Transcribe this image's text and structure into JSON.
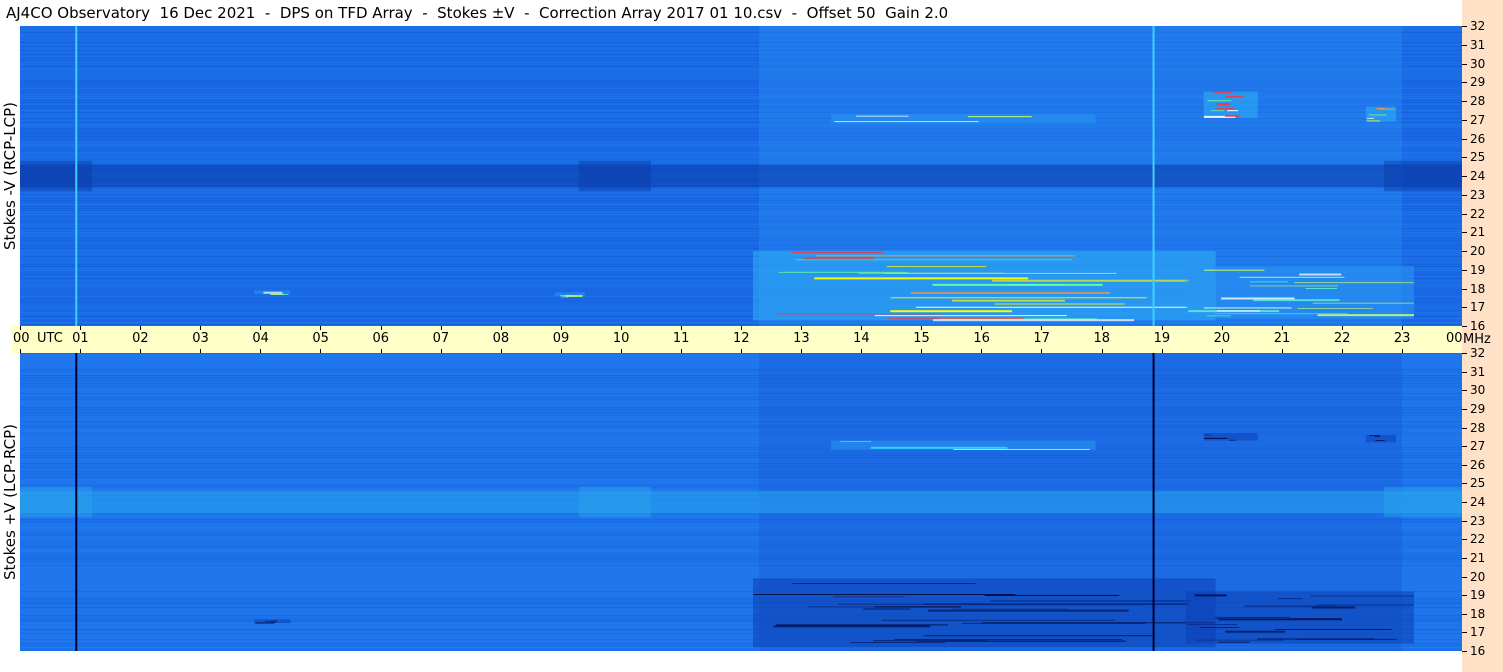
{
  "title": "AJ4CO Observatory  16 Dec 2021  -  DPS on TFD Array  -  Stokes ±V  -  Correction Array 2017 01 10.csv  -  Offset 50  Gain 2.0",
  "chart_data": {
    "type": "heatmap",
    "panels": [
      {
        "name": "top",
        "ylabel": "Stokes -V (RCP-LCP)",
        "baseline_color": "#1a6ae6",
        "marker_line_color": "#3fd0ff",
        "marker_lines_utc_hours": [
          0.92,
          18.85
        ],
        "dark_band_freq_mhz": [
          23.4,
          24.6
        ],
        "bursts": [
          {
            "start_utc": 12.2,
            "end_utc": 19.9,
            "freq_low": 16.3,
            "freq_high": 20.0,
            "intensity": "high"
          },
          {
            "start_utc": 19.4,
            "end_utc": 23.2,
            "freq_low": 16.4,
            "freq_high": 19.2,
            "intensity": "medium"
          },
          {
            "start_utc": 13.5,
            "end_utc": 17.9,
            "freq_low": 26.8,
            "freq_high": 27.3,
            "intensity": "medium"
          },
          {
            "start_utc": 19.7,
            "end_utc": 20.6,
            "freq_low": 27.1,
            "freq_high": 28.5,
            "intensity": "high"
          },
          {
            "start_utc": 22.4,
            "end_utc": 22.9,
            "freq_low": 26.9,
            "freq_high": 27.7,
            "intensity": "high"
          },
          {
            "start_utc": 3.9,
            "end_utc": 4.5,
            "freq_low": 17.7,
            "freq_high": 17.9,
            "intensity": "medium"
          },
          {
            "start_utc": 8.9,
            "end_utc": 9.4,
            "freq_low": 17.6,
            "freq_high": 17.8,
            "intensity": "medium"
          }
        ]
      },
      {
        "name": "bottom",
        "ylabel": "Stokes +V (LCP-RCP)",
        "baseline_color": "#1e74ea",
        "marker_line_color": "#000033",
        "marker_lines_utc_hours": [
          0.92,
          18.85
        ],
        "bright_band_freq_mhz": [
          23.4,
          24.6
        ],
        "bursts": [
          {
            "start_utc": 12.2,
            "end_utc": 19.9,
            "freq_low": 16.2,
            "freq_high": 19.9,
            "intensity": "low"
          },
          {
            "start_utc": 19.4,
            "end_utc": 23.2,
            "freq_low": 16.4,
            "freq_high": 19.2,
            "intensity": "low"
          },
          {
            "start_utc": 13.5,
            "end_utc": 17.9,
            "freq_low": 26.8,
            "freq_high": 27.3,
            "intensity": "medium"
          },
          {
            "start_utc": 19.7,
            "end_utc": 20.6,
            "freq_low": 27.3,
            "freq_high": 27.7,
            "intensity": "low"
          },
          {
            "start_utc": 22.4,
            "end_utc": 22.9,
            "freq_low": 27.2,
            "freq_high": 27.6,
            "intensity": "low"
          },
          {
            "start_utc": 3.9,
            "end_utc": 4.5,
            "freq_low": 17.5,
            "freq_high": 17.7,
            "intensity": "low"
          }
        ]
      }
    ],
    "x_ticks": [
      "00",
      "01",
      "02",
      "03",
      "04",
      "05",
      "06",
      "07",
      "08",
      "09",
      "10",
      "11",
      "12",
      "13",
      "14",
      "15",
      "16",
      "17",
      "18",
      "19",
      "20",
      "21",
      "22",
      "23",
      "00"
    ],
    "x_unit": "UTC",
    "xlim": [
      0,
      24
    ],
    "y_ticks": [
      "16",
      "17",
      "18",
      "19",
      "20",
      "21",
      "22",
      "23",
      "24",
      "25",
      "26",
      "27",
      "28",
      "29",
      "30",
      "31",
      "32"
    ],
    "y_unit": "MHz",
    "ylim": [
      16,
      32
    ]
  }
}
